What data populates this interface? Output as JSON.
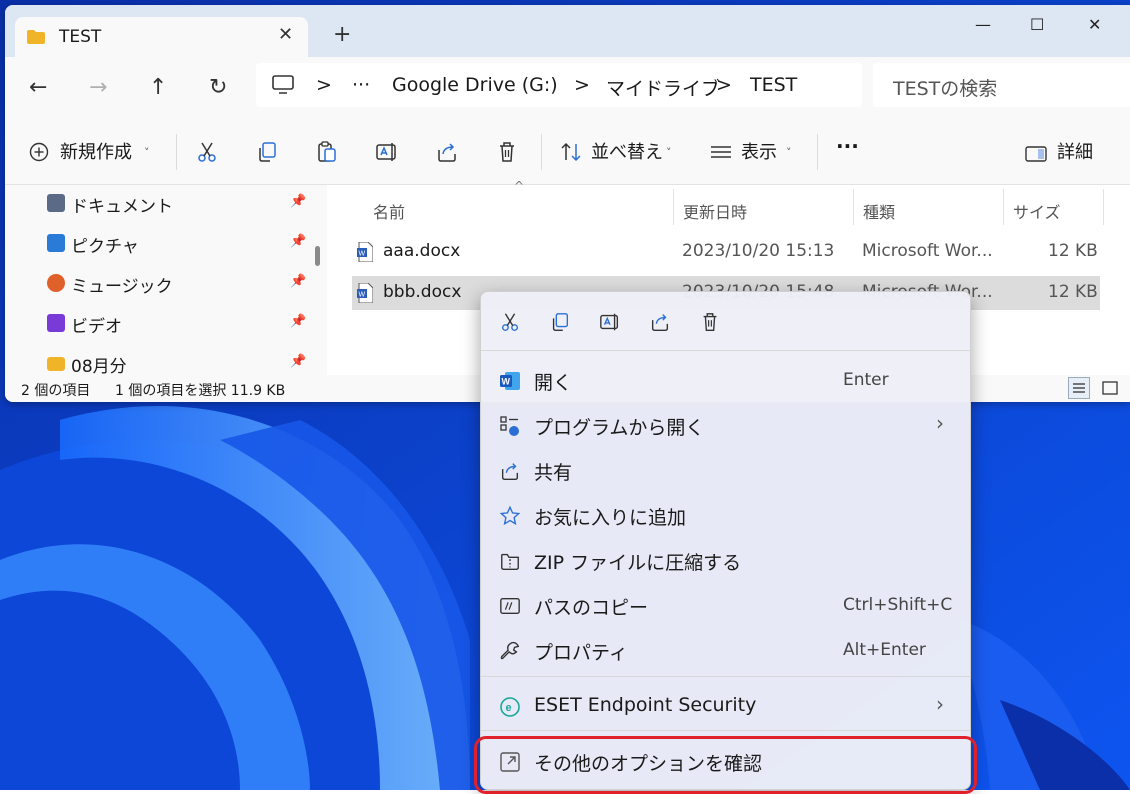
{
  "window": {
    "tab_title": "TEST",
    "tab_close": "✕",
    "new_tab": "+",
    "minimize": "—",
    "maximize": "☐",
    "close": "✕"
  },
  "nav": {
    "back": "←",
    "forward": "→",
    "up": "↑",
    "refresh": "↻"
  },
  "address": {
    "more": "···",
    "crumbs": [
      "Google Drive (G:)",
      "マイドライブ",
      "TEST"
    ],
    "separator": ">"
  },
  "search": {
    "placeholder": "TESTの検索"
  },
  "toolbar": {
    "new_label": "新規作成",
    "sort_label": "並べ替え",
    "view_label": "表示",
    "more_label": "···",
    "details_label": "詳細"
  },
  "sidebar": {
    "items": [
      {
        "label": "ドキュメント",
        "icon": "documents-icon",
        "color": "#5b6b87"
      },
      {
        "label": "ピクチャ",
        "icon": "pictures-icon",
        "color": "#2a7bd8"
      },
      {
        "label": "ミュージック",
        "icon": "music-icon",
        "color": "#e0602a"
      },
      {
        "label": "ビデオ",
        "icon": "videos-icon",
        "color": "#7a3ad8"
      },
      {
        "label": "08月分",
        "icon": "folder-icon",
        "color": "#f0b429"
      }
    ]
  },
  "columns": {
    "name": "名前",
    "modified": "更新日時",
    "type": "種類",
    "size": "サイズ"
  },
  "files": [
    {
      "name": "aaa.docx",
      "modified": "2023/10/20 15:13",
      "type": "Microsoft Wor...",
      "size": "12 KB",
      "selected": false
    },
    {
      "name": "bbb.docx",
      "modified": "2023/10/20 15:48",
      "type": "Microsoft Wor...",
      "size": "12 KB",
      "selected": true
    }
  ],
  "status": {
    "count": "2 個の項目",
    "selection": "1 個の項目を選択  11.9 KB"
  },
  "context_menu": {
    "quick_actions": [
      "cut-icon",
      "copy-icon",
      "rename-icon",
      "share-icon",
      "delete-icon"
    ],
    "items": [
      {
        "label": "開く",
        "shortcut": "Enter",
        "icon": "word-icon",
        "submenu": false
      },
      {
        "label": "プログラムから開く",
        "shortcut": "",
        "icon": "open-with-icon",
        "submenu": true
      },
      {
        "label": "共有",
        "shortcut": "",
        "icon": "share-icon",
        "submenu": false
      },
      {
        "label": "お気に入りに追加",
        "shortcut": "",
        "icon": "star-icon",
        "submenu": false
      },
      {
        "label": "ZIP ファイルに圧縮する",
        "shortcut": "",
        "icon": "zip-icon",
        "submenu": false
      },
      {
        "label": "パスのコピー",
        "shortcut": "Ctrl+Shift+C",
        "icon": "copy-path-icon",
        "submenu": false
      },
      {
        "label": "プロパティ",
        "shortcut": "Alt+Enter",
        "icon": "wrench-icon",
        "submenu": false
      },
      {
        "label": "ESET Endpoint Security",
        "shortcut": "",
        "icon": "eset-icon",
        "submenu": true
      },
      {
        "label": "その他のオプションを確認",
        "shortcut": "",
        "icon": "more-options-icon",
        "submenu": false
      }
    ],
    "arrow": "›"
  },
  "colors": {
    "highlight": "#e0202a",
    "accent": "#2b6fd6",
    "selected_row": "#cce4f7"
  }
}
